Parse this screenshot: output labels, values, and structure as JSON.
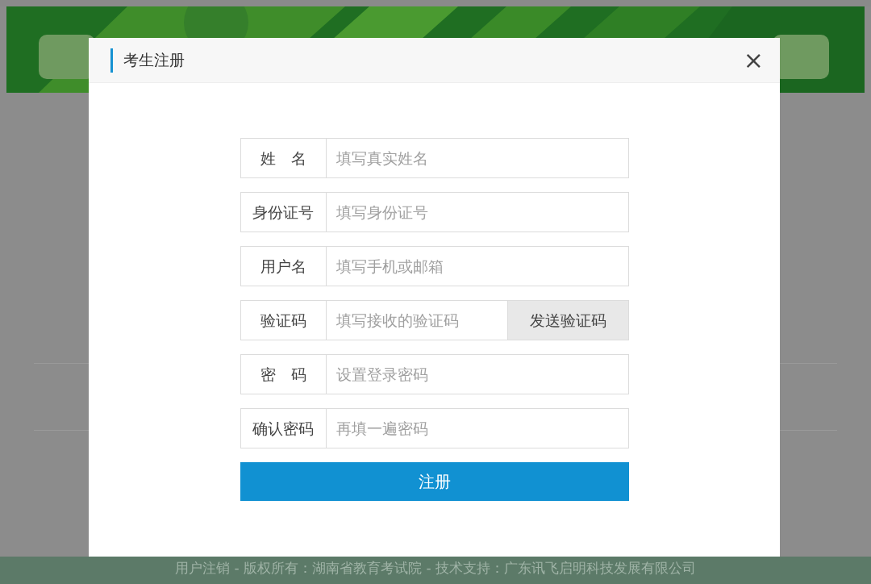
{
  "footer": {
    "text": "用户注销 - 版权所有：湖南省教育考试院 - 技术支持：广东讯飞启明科技发展有限公司"
  },
  "dialog": {
    "title": "考生注册",
    "close": "×",
    "fields": [
      {
        "kind": "text",
        "label": "姓　名",
        "placeholder": "填写真实姓名"
      },
      {
        "kind": "text",
        "label": "身份证号",
        "placeholder": "填写身份证号"
      },
      {
        "kind": "text",
        "label": "用户名",
        "placeholder": "填写手机或邮箱"
      },
      {
        "kind": "code",
        "label": "验证码",
        "placeholder": "填写接收的验证码",
        "button": "发送验证码"
      },
      {
        "kind": "password",
        "label": "密　码",
        "placeholder": "设置登录密码"
      },
      {
        "kind": "password",
        "label": "确认密码",
        "placeholder": "再填一遍密码"
      }
    ],
    "submit": "注册"
  }
}
